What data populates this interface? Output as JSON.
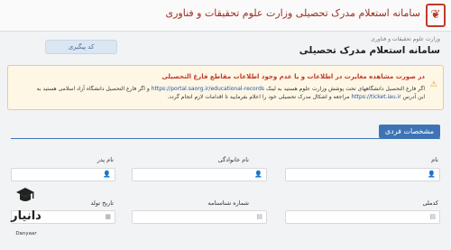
{
  "header": {
    "emblem_icon": "emblem-icon",
    "title": "سامانه استعلام مدرک تحصیلی وزارت علوم تحقیقات و فناوری"
  },
  "toolbar": {
    "tracking_label": "کد پیگیری"
  },
  "breadcrumb": "وزارت علوم تحقیقات و فناوری",
  "page_title": "سامانه استعلام مدرک تحصیلی",
  "alert": {
    "heading": "در صورت مشاهده مغایرت در اطلاعات و یا عدم وجود اطلاعات مقاطع فارغ التحصیلی",
    "body_part1": "اگر فارغ التحصیل دانشگاههای تحت پوشش وزارت علوم هستید به لینک",
    "link1": "https://portal.saorg.ir/educational-records",
    "body_part2": "و اگر فارغ التحصیل دانشگاه آزاد اسلامی هستید به",
    "body_part3": "این آدرس",
    "link2": "https://ticket.iau.ir",
    "body_part4": "مراجعه و اشکال مدرک تحصیلی خود را اعلام بفرمایید تا اقدامات لازم انجام گردد."
  },
  "section": {
    "title": "مشخصات فردی"
  },
  "form": {
    "name_label": "نام",
    "family_label": "نام خانوادگی",
    "father_label": "نام پدر",
    "national_code_label": "کدملی",
    "id_number_label": "شماره شناسنامه",
    "birth_date_label": "تاریخ تولد"
  },
  "logo": {
    "name": "دانیار",
    "sub": "Danyaar"
  }
}
